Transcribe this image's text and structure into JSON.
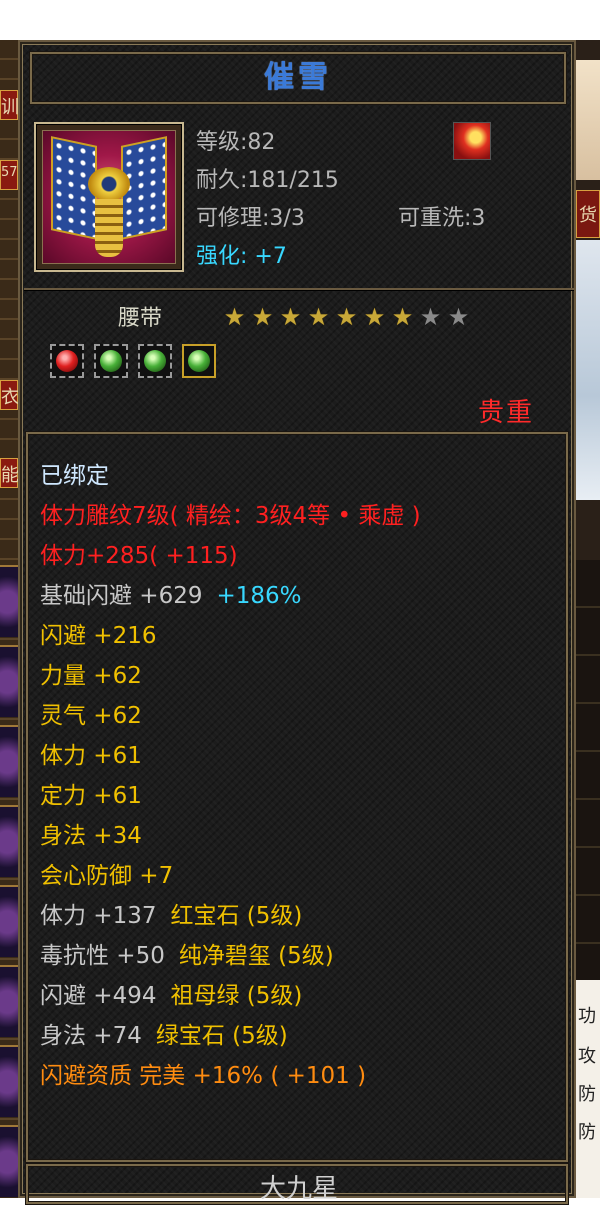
{
  "background": {
    "left_glyphs": [
      "训",
      "57",
      "衣",
      "能"
    ],
    "right_glyphs": [
      "货",
      "功",
      "攻",
      "防",
      "防"
    ]
  },
  "item": {
    "name": "催雪",
    "icon": "belt-item-icon",
    "level_text": "等级:82",
    "durability_text": "耐久:181/215",
    "repairable_text": "可修理:3/3",
    "rewashable_text": "可重洗:3",
    "enhance_label": "强化:",
    "enhance_value": "+7",
    "type": "腰带",
    "stars_total": 9,
    "stars_filled": 7,
    "rarity": "贵重",
    "gem_slots": [
      {
        "gem": "red"
      },
      {
        "gem": "green"
      },
      {
        "gem": "green"
      },
      {
        "gem": "green",
        "selected": true
      }
    ]
  },
  "attributes": [
    {
      "text": "已绑定",
      "color": "#cfe8ff"
    },
    {
      "text": "体力雕纹7级( 精绘：3级4等 • 乘虚 )",
      "color": "#ff2020"
    },
    {
      "text": "体力+285( +115)",
      "color": "#ff2020"
    },
    {
      "text": "基础闪避 +629",
      "extra": "+186%",
      "color": "#c8c8c8",
      "extra_color": "#38d8ff"
    },
    {
      "text": "闪避 +216",
      "color": "#f0c000"
    },
    {
      "text": "力量 +62",
      "color": "#f0c000"
    },
    {
      "text": "灵气 +62",
      "color": "#f0c000"
    },
    {
      "text": "体力 +61",
      "color": "#f0c000"
    },
    {
      "text": "定力 +61",
      "color": "#f0c000"
    },
    {
      "text": "身法 +34",
      "color": "#f0c000"
    },
    {
      "text": "会心防御 +7",
      "color": "#f0c000"
    },
    {
      "text": "体力 +137",
      "extra": "红宝石 (5级)",
      "color": "#c8c8c8",
      "extra_color": "#f0c000"
    },
    {
      "text": "毒抗性 +50",
      "extra": "纯净碧玺 (5级)",
      "color": "#c8c8c8",
      "extra_color": "#f0c000"
    },
    {
      "text": "闪避 +494",
      "extra": "祖母绿 (5级)",
      "color": "#c8c8c8",
      "extra_color": "#f0c000"
    },
    {
      "text": "身法 +74",
      "extra": "绿宝石 (5级)",
      "color": "#c8c8c8",
      "extra_color": "#f0c000"
    },
    {
      "text": "闪避资质  完美 +16% ( +101 )",
      "color": "#ff8c10"
    }
  ],
  "footer": "大九星",
  "colors": {
    "title": "#3a7ad8",
    "rarity": "#ff2a2a",
    "star_on": "#c8a838",
    "star_off": "#8a8a8a"
  }
}
